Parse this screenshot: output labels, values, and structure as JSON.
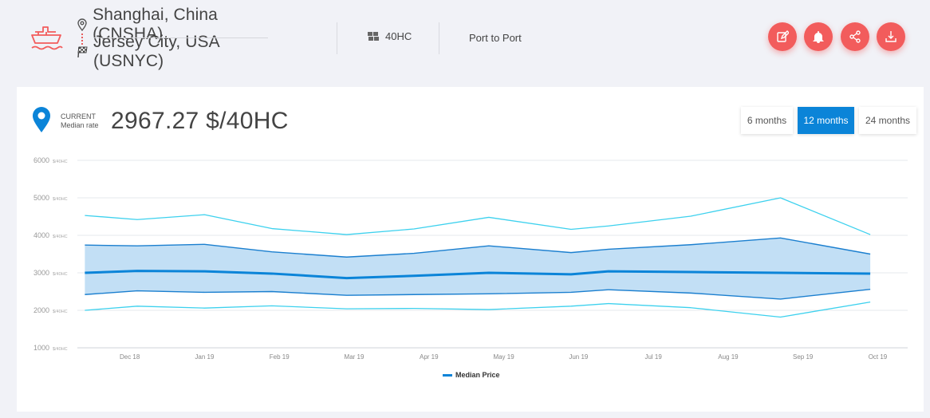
{
  "header": {
    "origin": "Shanghai, China (CNSHA)",
    "destination": "Jersey City, USA (USNYC)",
    "container_type": "40HC",
    "service_mode": "Port to Port",
    "icons": [
      "ship-icon",
      "location-pin-icon",
      "checkered-flag-icon",
      "container-icon",
      "edit-icon",
      "bell-icon",
      "share-icon",
      "download-icon"
    ]
  },
  "rate": {
    "label_line1": "CURRENT",
    "label_line2": "Median rate",
    "value": "2967.27 $/40HC"
  },
  "ranges": [
    {
      "label": "6 months",
      "active": false
    },
    {
      "label": "12 months",
      "active": true
    },
    {
      "label": "24 months",
      "active": false
    }
  ],
  "colors": {
    "accent_red": "#f25c5c",
    "primary_blue": "#0b84d8",
    "outer_band": "#3dd1ee",
    "inner_band_fill": "#c2dff5"
  },
  "chart_data": {
    "type": "line",
    "ylim": [
      1000,
      6000
    ],
    "yticks": [
      {
        "value": 6000,
        "label": "6000",
        "unit": "$/40HC"
      },
      {
        "value": 5000,
        "label": "5000",
        "unit": "$/40HC"
      },
      {
        "value": 4000,
        "label": "4000",
        "unit": "$/40HC"
      },
      {
        "value": 3000,
        "label": "3000",
        "unit": "$/40HC"
      },
      {
        "value": 2000,
        "label": "2000",
        "unit": "$/40HC"
      },
      {
        "value": 1000,
        "label": "1000",
        "unit": "$/40HC"
      }
    ],
    "xticks": [
      {
        "pos": 0.6,
        "label": "Dec 18"
      },
      {
        "pos": 1.6,
        "label": "Jan 19"
      },
      {
        "pos": 2.6,
        "label": "Feb 19"
      },
      {
        "pos": 3.6,
        "label": "Mar 19"
      },
      {
        "pos": 4.6,
        "label": "Apr 19"
      },
      {
        "pos": 5.6,
        "label": "May 19"
      },
      {
        "pos": 6.6,
        "label": "Jun 19"
      },
      {
        "pos": 7.6,
        "label": "Jul 19"
      },
      {
        "pos": 8.6,
        "label": "Aug 19"
      },
      {
        "pos": 9.6,
        "label": "Sep 19"
      },
      {
        "pos": 10.6,
        "label": "Oct 19"
      }
    ],
    "x": [
      0,
      0.7,
      1.6,
      2.5,
      3.5,
      4.4,
      5.4,
      6.5,
      7.0,
      8.1,
      9.3,
      10.5
    ],
    "series": [
      {
        "name": "upper-outer",
        "values": [
          4530,
          4420,
          4550,
          4180,
          4020,
          4170,
          4480,
          4160,
          4250,
          4510,
          5000,
          4020
        ]
      },
      {
        "name": "upper-inner",
        "values": [
          3740,
          3720,
          3760,
          3560,
          3420,
          3520,
          3720,
          3540,
          3630,
          3750,
          3930,
          3500
        ]
      },
      {
        "name": "Median Price",
        "values": [
          3000,
          3050,
          3040,
          2980,
          2860,
          2920,
          3000,
          2960,
          3040,
          3020,
          3000,
          2980
        ]
      },
      {
        "name": "lower-inner",
        "values": [
          2420,
          2520,
          2480,
          2500,
          2400,
          2420,
          2440,
          2480,
          2550,
          2460,
          2300,
          2560
        ]
      },
      {
        "name": "lower-outer",
        "values": [
          2000,
          2110,
          2060,
          2120,
          2040,
          2050,
          2020,
          2110,
          2180,
          2070,
          1820,
          2220
        ]
      }
    ],
    "legend": [
      {
        "name": "Median Price"
      }
    ],
    "legend_position": "bottom-center",
    "grid": true
  }
}
